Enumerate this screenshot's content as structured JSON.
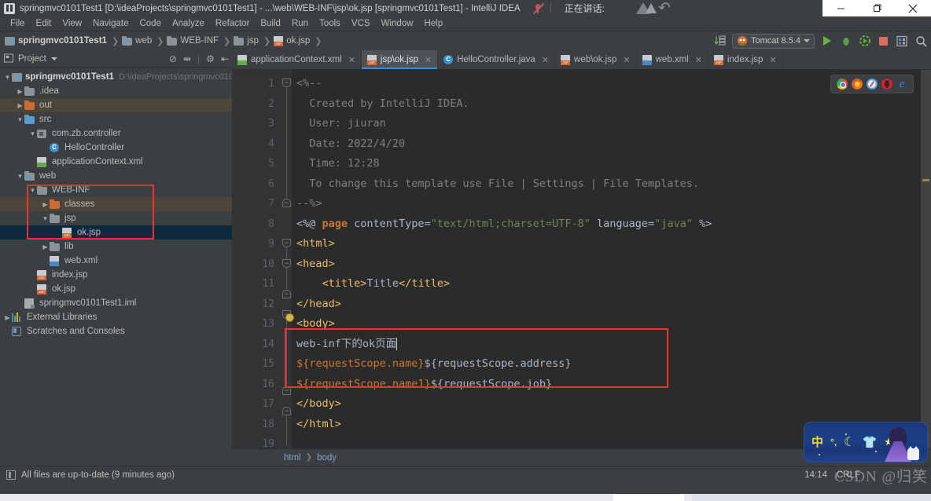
{
  "titlebar": {
    "title": "springmvc0101Test1 [D:\\ideaProjects\\springmvc0101Test1] - ...\\web\\WEB-INF\\jsp\\ok.jsp [springmvc0101Test1] - IntelliJ IDEA",
    "speaking_label": "正在讲话:",
    "minimize": "—",
    "maximize": "❐",
    "close": "✕"
  },
  "menubar": {
    "items": [
      "File",
      "Edit",
      "View",
      "Navigate",
      "Code",
      "Analyze",
      "Refactor",
      "Build",
      "Run",
      "Tools",
      "VCS",
      "Window",
      "Help"
    ]
  },
  "navbar": {
    "crumbs": [
      {
        "label": "springmvc0101Test1",
        "icon": "module-icon"
      },
      {
        "label": "web",
        "icon": "web-folder-icon"
      },
      {
        "label": "WEB-INF",
        "icon": "folder-icon"
      },
      {
        "label": "jsp",
        "icon": "folder-icon"
      },
      {
        "label": "ok.jsp",
        "icon": "jsp-file-icon"
      }
    ],
    "run_config": "Tomcat 8.5.4",
    "buttons": [
      "run-button",
      "debug-button",
      "run-coverage-button",
      "stop-button",
      "layout-button",
      "search-button"
    ]
  },
  "project_panel": {
    "title": "Project",
    "tree": [
      {
        "indent": 0,
        "arrow": "▼",
        "icon": "module-icon",
        "name": "springmvc0101Test1",
        "bold": true,
        "path": "D:\\ideaProjects\\springmvc010",
        "state": "normal"
      },
      {
        "indent": 1,
        "arrow": "▶",
        "icon": "folder-icon",
        "name": ".idea",
        "bold": false,
        "path": "",
        "state": "normal"
      },
      {
        "indent": 1,
        "arrow": "▶",
        "icon": "folder-orange-icon",
        "name": "out",
        "bold": false,
        "path": "",
        "state": "hover"
      },
      {
        "indent": 1,
        "arrow": "▼",
        "icon": "folder-blue-icon",
        "name": "src",
        "bold": false,
        "path": "",
        "state": "normal"
      },
      {
        "indent": 2,
        "arrow": "▼",
        "icon": "package-icon",
        "name": "com.zb.controller",
        "bold": false,
        "path": "",
        "state": "normal"
      },
      {
        "indent": 3,
        "arrow": "",
        "icon": "java-class-icon",
        "name": "HelloController",
        "bold": false,
        "path": "",
        "state": "normal"
      },
      {
        "indent": 2,
        "arrow": "",
        "icon": "xml-file-icon",
        "name": "applicationContext.xml",
        "bold": false,
        "path": "",
        "state": "normal"
      },
      {
        "indent": 1,
        "arrow": "▼",
        "icon": "web-folder-icon",
        "name": "web",
        "bold": false,
        "path": "",
        "state": "normal"
      },
      {
        "indent": 2,
        "arrow": "▼",
        "icon": "folder-icon",
        "name": "WEB-INF",
        "bold": false,
        "path": "",
        "state": "normal"
      },
      {
        "indent": 3,
        "arrow": "▶",
        "icon": "folder-orange-icon",
        "name": "classes",
        "bold": false,
        "path": "",
        "state": "hover"
      },
      {
        "indent": 3,
        "arrow": "▼",
        "icon": "folder-icon",
        "name": "jsp",
        "bold": false,
        "path": "",
        "state": "normal"
      },
      {
        "indent": 4,
        "arrow": "",
        "icon": "jsp-file-icon",
        "name": "ok.jsp",
        "bold": false,
        "path": "",
        "state": "selected"
      },
      {
        "indent": 3,
        "arrow": "▶",
        "icon": "folder-icon",
        "name": "lib",
        "bold": false,
        "path": "",
        "state": "normal"
      },
      {
        "indent": 3,
        "arrow": "",
        "icon": "xml-blue-file-icon",
        "name": "web.xml",
        "bold": false,
        "path": "",
        "state": "normal"
      },
      {
        "indent": 2,
        "arrow": "",
        "icon": "jsp-file-icon",
        "name": "index.jsp",
        "bold": false,
        "path": "",
        "state": "normal"
      },
      {
        "indent": 2,
        "arrow": "",
        "icon": "jsp-file-icon",
        "name": "ok.jsp",
        "bold": false,
        "path": "",
        "state": "normal"
      },
      {
        "indent": 1,
        "arrow": "",
        "icon": "iml-file-icon",
        "name": "springmvc0101Test1.iml",
        "bold": false,
        "path": "",
        "state": "normal"
      },
      {
        "indent": 0,
        "arrow": "▶",
        "icon": "libraries-icon",
        "name": "External Libraries",
        "bold": false,
        "path": "",
        "state": "normal"
      },
      {
        "indent": 0,
        "arrow": "",
        "icon": "scratches-icon",
        "name": "Scratches and Consoles",
        "bold": false,
        "path": "",
        "state": "normal"
      }
    ]
  },
  "editor": {
    "tabs": [
      {
        "label": "applicationContext.xml",
        "icon": "xml-file-icon",
        "active": false
      },
      {
        "label": "jsp\\ok.jsp",
        "icon": "jsp-file-icon",
        "active": true
      },
      {
        "label": "HelloController.java",
        "icon": "java-class-icon",
        "active": false
      },
      {
        "label": "web\\ok.jsp",
        "icon": "jsp-file-icon",
        "active": false
      },
      {
        "label": "web.xml",
        "icon": "xml-blue-file-icon",
        "active": false
      },
      {
        "label": "index.jsp",
        "icon": "jsp-file-icon",
        "active": false
      }
    ],
    "line_numbers": [
      "1",
      "2",
      "3",
      "4",
      "5",
      "6",
      "7",
      "8",
      "9",
      "10",
      "11",
      "12",
      "13",
      "14",
      "15",
      "16",
      "17",
      "18",
      "19"
    ],
    "lines": [
      "<%--",
      "  Created by IntelliJ IDEA.",
      "  User: jiuran",
      "  Date: 2022/4/20",
      "  Time: 12:28",
      "  To change this template use File | Settings | File Templates.",
      "--%>",
      "<%@ page contentType=\"text/html;charset=UTF-8\" language=\"java\" %>",
      "<html>",
      "<head>",
      "    <title>Title</title>",
      "</head>",
      "<body>",
      "web-inf下的ok页面",
      "${requestScope.name}${requestScope.address}",
      "${requestScope.name1}${requestScope.job}",
      "</body>",
      "</html>",
      ""
    ],
    "breadcrumbs": [
      "html",
      "body"
    ],
    "browsers": [
      "chrome-icon",
      "firefox-icon",
      "safari-icon",
      "opera-icon",
      "ie-icon"
    ]
  },
  "statusbar": {
    "message": "All files are up-to-date (9 minutes ago)",
    "time": "14:14",
    "line_separator": "CRLF",
    "watermark": "CSDN @归笑"
  },
  "ime": {
    "lang_button": "中",
    "mode_button": "°,",
    "theme_button": "moon-icon",
    "skin_button": "shirt-icon",
    "star_button": "star-icon"
  },
  "colors": {
    "accent_blue": "#4a88c7",
    "selection_blue": "#0d293e",
    "annotation_red": "#ff2d2d",
    "editor_bg": "#2b2b2b",
    "chrome_bg": "#3c3f41"
  }
}
